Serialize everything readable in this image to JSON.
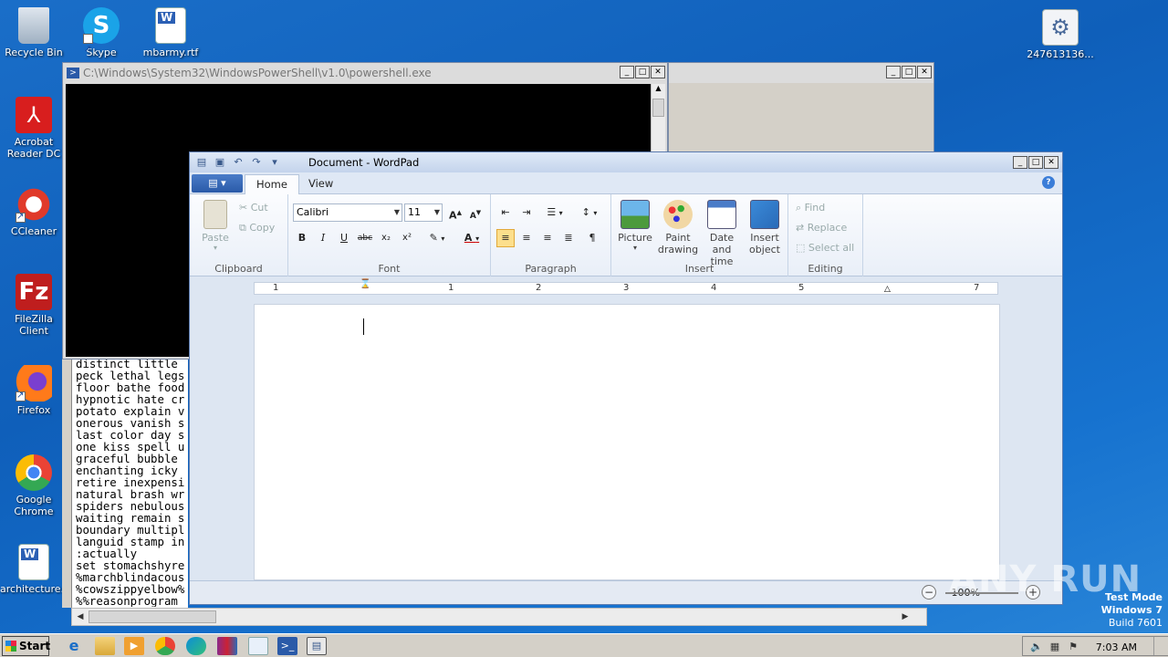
{
  "desktop": {
    "icons": [
      {
        "label": "Recycle Bin",
        "icon": "recycle-bin-icon"
      },
      {
        "label": "Skype",
        "icon": "skype-icon"
      },
      {
        "label": "mbarmy.rtf",
        "icon": "word-document-icon"
      },
      {
        "label": "Acrobat Reader DC",
        "icon": "acrobat-icon"
      },
      {
        "label": "CCleaner",
        "icon": "ccleaner-icon"
      },
      {
        "label": "FileZilla Client",
        "icon": "filezilla-icon"
      },
      {
        "label": "Firefox",
        "icon": "firefox-icon"
      },
      {
        "label": "Google Chrome",
        "icon": "chrome-icon"
      },
      {
        "label": "architecture...",
        "icon": "word-document-icon"
      },
      {
        "label": "247613136...",
        "icon": "settings-file-icon"
      }
    ]
  },
  "powershell": {
    "title": "C:\\Windows\\System32\\WindowsPowerShell\\v1.0\\powershell.exe"
  },
  "console_text": "distinct little\npeck lethal legs\nfloor bathe food\nhypnotic hate cr\npotato explain v\nonerous vanish s\nlast color day s\none kiss spell u\ngraceful bubble\nenchanting icky\nretire inexpensi\nnatural brash wr\nspiders nebulous\nwaiting remain s\nboundary multipl\nlanguid stamp in\n:actually\nset stomachshyre\n%marchblindacous\n%cowszippyelbow%\n%%reasonprogram",
  "wordpad": {
    "title": "Document - WordPad",
    "tabs": [
      "Home",
      "View"
    ],
    "active_tab": "Home",
    "clipboard": {
      "paste": "Paste",
      "cut": "Cut",
      "copy": "Copy",
      "label": "Clipboard"
    },
    "font": {
      "family": "Calibri",
      "size": "11",
      "label": "Font"
    },
    "paragraph": {
      "label": "Paragraph"
    },
    "insert": {
      "picture": "Picture",
      "paint_drawing": "Paint drawing",
      "date_time": "Date and time",
      "insert_object": "Insert object",
      "label": "Insert"
    },
    "editing": {
      "find": "Find",
      "replace": "Replace",
      "select_all": "Select all",
      "label": "Editing"
    },
    "ruler_numbers": [
      "1",
      "1",
      "2",
      "3",
      "4",
      "5",
      "7"
    ],
    "zoom": "100%"
  },
  "watermark": "ANY RUN",
  "os_info": {
    "line1": "Test Mode",
    "line2": "Windows 7",
    "line3": "Build 7601"
  },
  "taskbar": {
    "start": "Start",
    "clock": "7:03 AM",
    "apps": [
      "ie-icon",
      "explorer-icon",
      "media-player-icon",
      "chrome-icon",
      "edge-icon",
      "winrar-icon",
      "notepad-icon",
      "powershell-icon",
      "wordpad-icon"
    ]
  },
  "colors": {
    "desktop": "#1565c0",
    "ribbon_selected": "#fcdf8c"
  }
}
